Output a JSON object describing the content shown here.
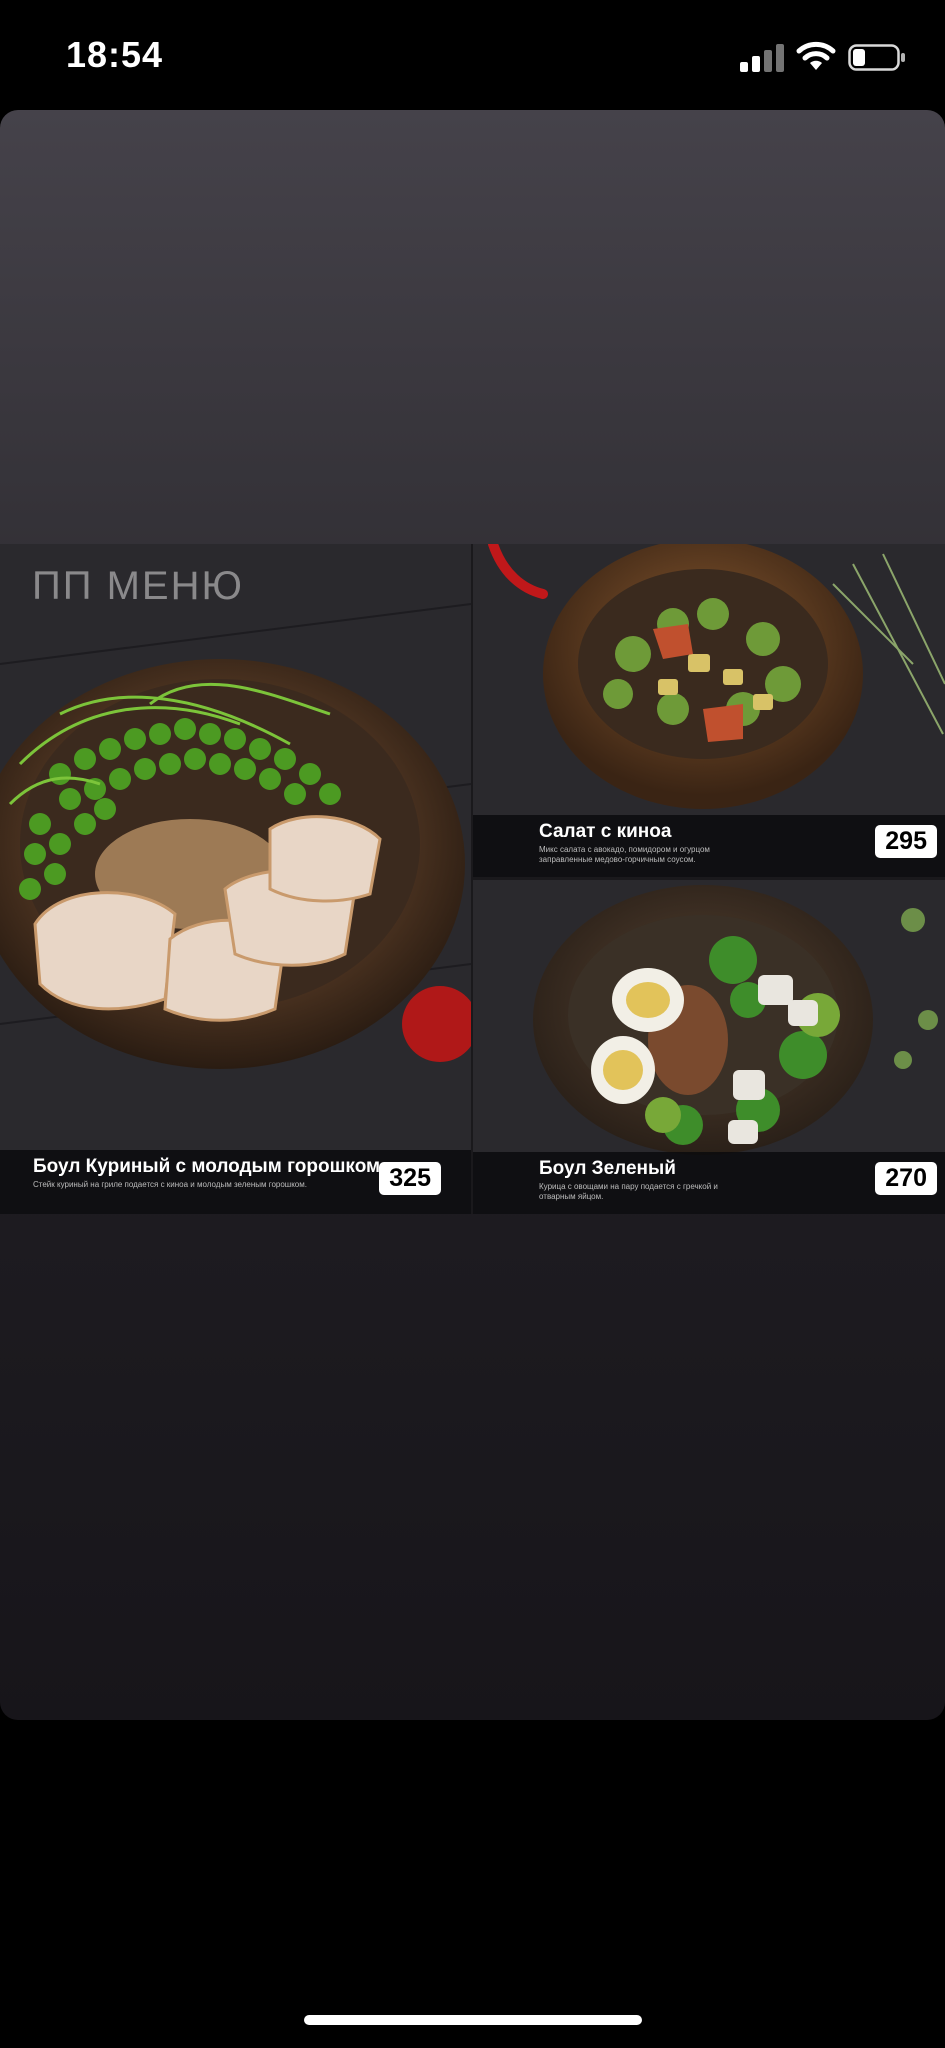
{
  "status_bar": {
    "time": "18:54",
    "icons": [
      "cellular-signal-icon",
      "wifi-icon",
      "battery-icon"
    ]
  },
  "menu": {
    "overlay_label": "ПП МЕНЮ",
    "items": [
      {
        "title": "Боул Куриный с молодым горошком",
        "description": "Стейк куриный на гриле подается с киноа и молодым зеленым горошком.",
        "price": "325"
      },
      {
        "title": "Салат с киноа",
        "description": "Микс салата с авокадо, помидором и огурцом заправленные медово-горчичным соусом.",
        "price": "295"
      },
      {
        "title": "Боул Зеленый",
        "description": "Курица с овощами на пару подается с гречкой и отварным яйцом.",
        "price": "270"
      }
    ]
  },
  "colors": {
    "background": "#000000",
    "viewer_top": "#45424a",
    "viewer_bottom": "#17151a",
    "price_tag": "#ffffff"
  }
}
